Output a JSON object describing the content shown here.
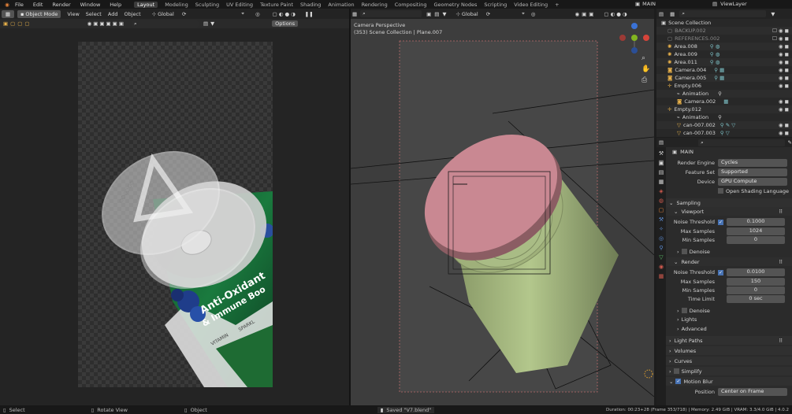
{
  "menu": {
    "items": [
      "File",
      "Edit",
      "Render",
      "Window",
      "Help"
    ]
  },
  "workspaces": [
    "Layout",
    "Modeling",
    "Sculpting",
    "UV Editing",
    "Texture Paint",
    "Shading",
    "Animation",
    "Rendering",
    "Compositing",
    "Geometry Nodes",
    "Scripting",
    "Video Editing"
  ],
  "workspace_active": "Layout",
  "add_tab": "+",
  "scene": {
    "name": "MAIN",
    "view_layer": "ViewLayer"
  },
  "left_editor": {
    "mode": "Object Mode",
    "menus": [
      "View",
      "Select",
      "Add",
      "Object"
    ],
    "orientation": "Global",
    "options": "Options"
  },
  "right_editor": {
    "orientation": "Global",
    "overlay_title": "Camera Perspective",
    "overlay_sub": "(353) Scene Collection | Plane.007"
  },
  "outliner": {
    "root": "Scene Collection",
    "items": [
      {
        "name": "BACKUP.002",
        "dim": true
      },
      {
        "name": "REFERENCES.002",
        "dim": true
      },
      {
        "name": "Area.008"
      },
      {
        "name": "Area.009"
      },
      {
        "name": "Area.011"
      },
      {
        "name": "Camera.004"
      },
      {
        "name": "Camera.005"
      },
      {
        "name": "Empty.006"
      },
      {
        "name": "Animation",
        "child": true
      },
      {
        "name": "Camera.002",
        "child": true
      },
      {
        "name": "Empty.012"
      },
      {
        "name": "Animation",
        "child": true
      },
      {
        "name": "can-007.002",
        "child": true
      },
      {
        "name": "can-007.003",
        "child": true
      }
    ]
  },
  "properties": {
    "scene": "MAIN",
    "render_engine": {
      "label": "Render Engine",
      "value": "Cycles"
    },
    "feature_set": {
      "label": "Feature Set",
      "value": "Supported"
    },
    "device": {
      "label": "Device",
      "value": "GPU Compute"
    },
    "osl": "Open Shading Language",
    "sampling": "Sampling",
    "viewport": "Viewport",
    "vp_noise": {
      "label": "Noise Threshold",
      "value": "0.1000"
    },
    "vp_max": {
      "label": "Max Samples",
      "value": "1024"
    },
    "vp_min": {
      "label": "Min Samples",
      "value": "0"
    },
    "denoise": "Denoise",
    "render": "Render",
    "r_noise": {
      "label": "Noise Threshold",
      "value": "0.0100"
    },
    "r_max": {
      "label": "Max Samples",
      "value": "150"
    },
    "r_min": {
      "label": "Min Samples",
      "value": "0"
    },
    "r_time": {
      "label": "Time Limit",
      "value": "0 sec"
    },
    "denoise2": "Denoise",
    "lights": "Lights",
    "advanced": "Advanced",
    "light_paths": "Light Paths",
    "volumes": "Volumes",
    "curves": "Curves",
    "simplify": "Simplify",
    "motion_blur": "Motion Blur",
    "position": {
      "label": "Position",
      "value": "Center on Frame"
    }
  },
  "status": {
    "select": "Select",
    "rotate": "Rotate View",
    "object": "Object",
    "saved": "Saved \"V7.blend\"",
    "stats": "Duration: 00:23+28 (Frame 353/718) | Memory: 2.49 GiB | VRAM: 3.3/4.0 GiB | 4.0.2"
  },
  "colors": {
    "accent": "#4772b3",
    "lid_pink": "#c98892",
    "can_green": "#9db27a",
    "camera_frame": "#b96a6a"
  },
  "can_label": {
    "line1": "Anti-Oxidant",
    "line2": "& Immune Boo",
    "line3": "VITAMIN",
    "line4": "SPARKL"
  }
}
